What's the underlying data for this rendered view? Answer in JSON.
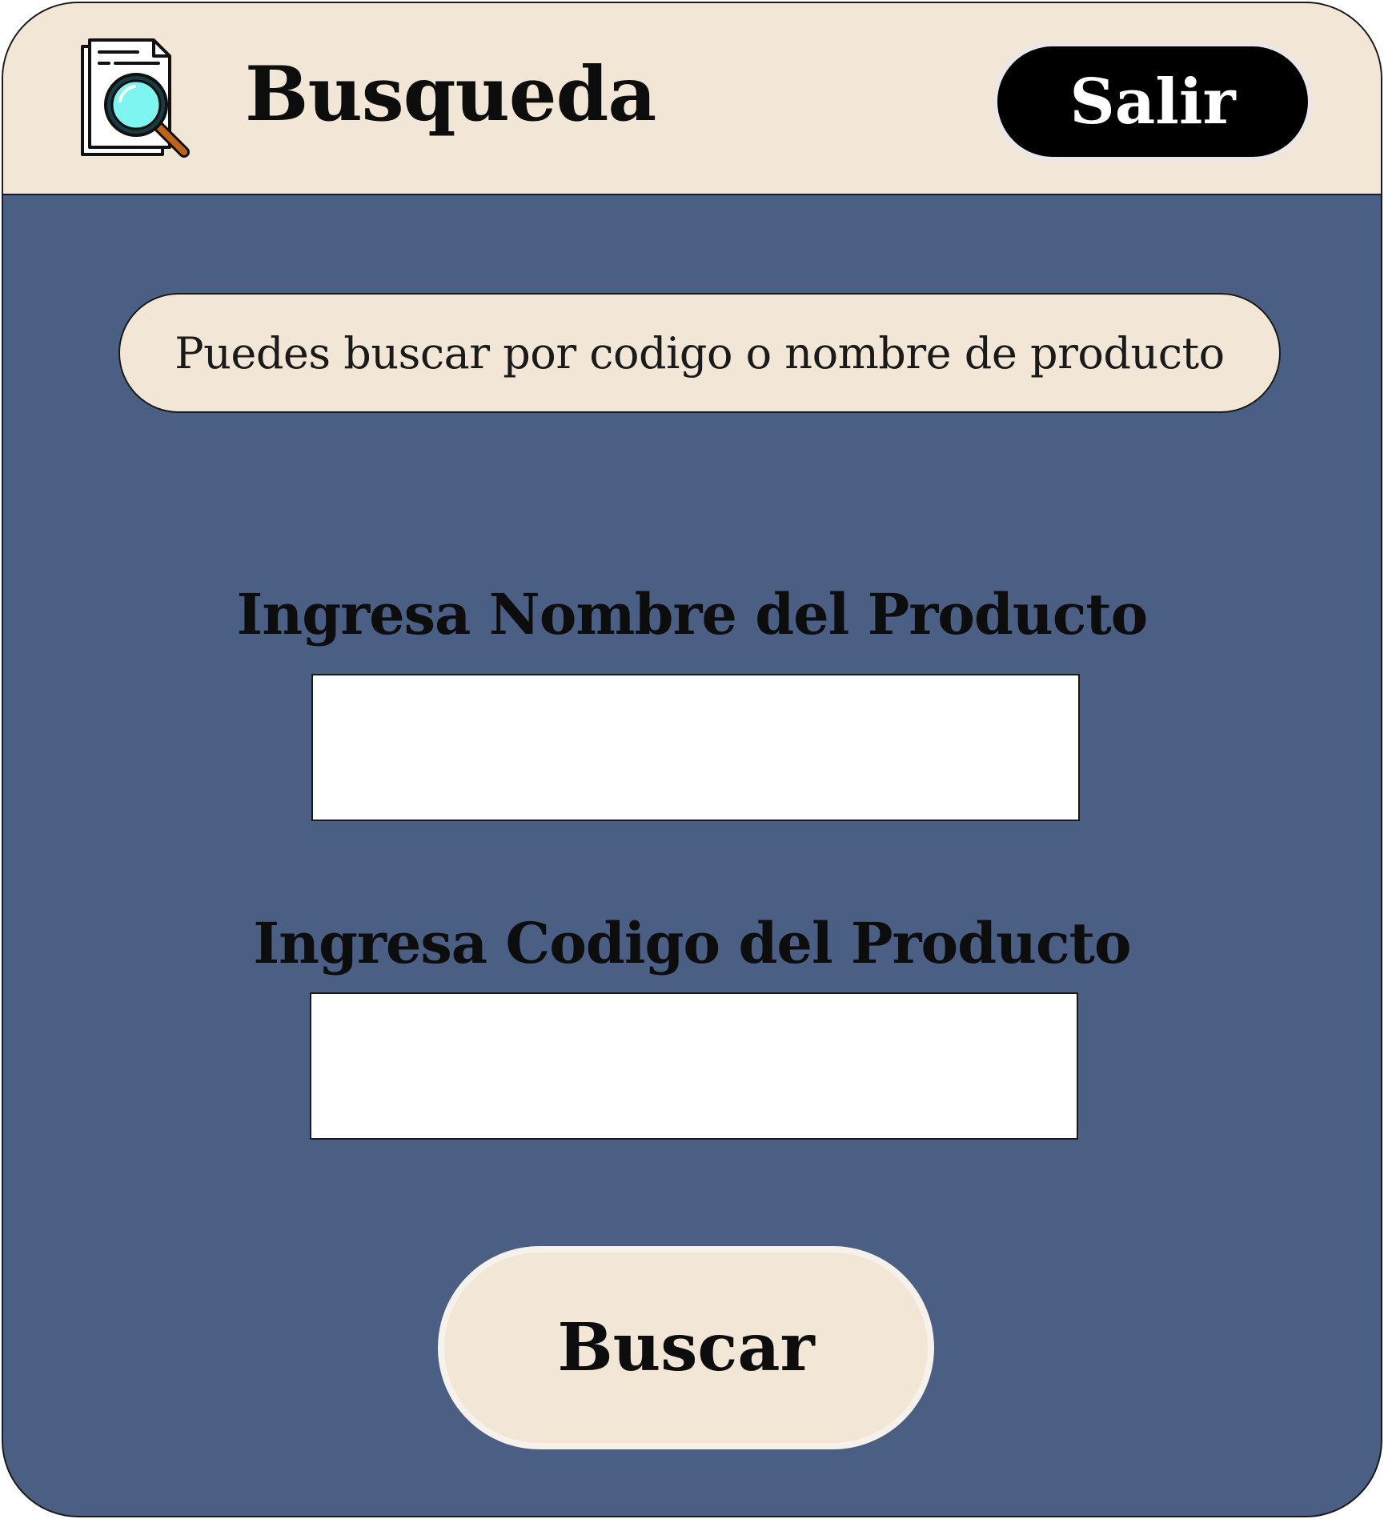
{
  "header": {
    "title": "Busqueda",
    "icon": "document-search-icon",
    "exit_label": "Salir"
  },
  "info": {
    "text": "Puedes buscar por codigo o nombre de producto"
  },
  "form": {
    "name_label": "Ingresa Nombre del Producto",
    "name_value": "",
    "code_label": "Ingresa Codigo del Producto",
    "code_value": "",
    "submit_label": "Buscar"
  },
  "colors": {
    "header_bg": "#f2e7d7",
    "body_bg": "#4b5f84",
    "exit_button_bg": "#000000",
    "icon_lens": "#7ff5f2",
    "icon_handle": "#c0621a"
  }
}
